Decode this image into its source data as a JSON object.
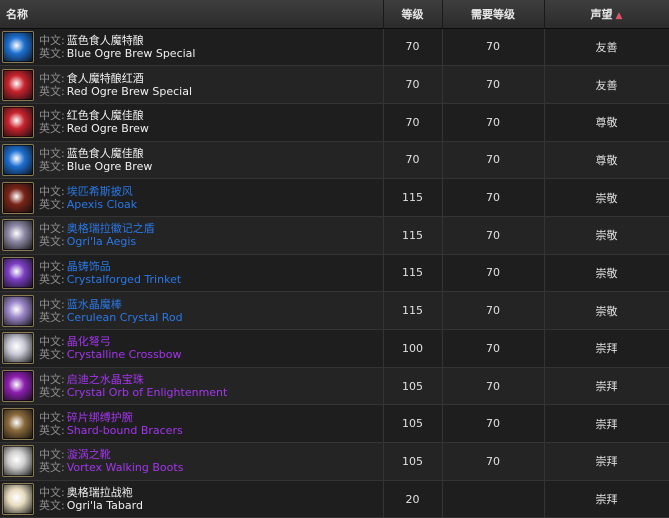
{
  "header": {
    "name": "名称",
    "level": "等级",
    "req_level": "需要等级",
    "reputation": "声望",
    "sort_arrow": "▲"
  },
  "labels": {
    "cn": "中文:",
    "en": "英文:"
  },
  "rows": [
    {
      "cn": "蓝色食人魔特酿",
      "en": "Blue Ogre Brew Special",
      "level": "70",
      "req": "70",
      "rep": "友善",
      "quality": "white",
      "icon": "blue-potion-icon",
      "color": "#1d6fd1"
    },
    {
      "cn": "食人魔特酿红酒",
      "en": "Red Ogre Brew Special",
      "level": "70",
      "req": "70",
      "rep": "友善",
      "quality": "white",
      "icon": "red-potion-icon",
      "color": "#c8232d"
    },
    {
      "cn": "红色食人魔佳酿",
      "en": "Red Ogre Brew",
      "level": "70",
      "req": "70",
      "rep": "尊敬",
      "quality": "white",
      "icon": "red-potion-icon",
      "color": "#c8232d"
    },
    {
      "cn": "蓝色食人魔佳酿",
      "en": "Blue Ogre Brew",
      "level": "70",
      "req": "70",
      "rep": "尊敬",
      "quality": "white",
      "icon": "blue-potion-icon",
      "color": "#1d6fd1"
    },
    {
      "cn": "埃匹希斯披风",
      "en": "Apexis Cloak",
      "level": "115",
      "req": "70",
      "rep": "崇敬",
      "quality": "blue",
      "icon": "cloak-icon",
      "color": "#7a2418"
    },
    {
      "cn": "奥格瑞拉徽记之盾",
      "en": "Ogri'la Aegis",
      "level": "115",
      "req": "70",
      "rep": "崇敬",
      "quality": "blue",
      "icon": "shield-icon",
      "color": "#8e8aa6"
    },
    {
      "cn": "晶铸饰品",
      "en": "Crystalforged Trinket",
      "level": "115",
      "req": "70",
      "rep": "崇敬",
      "quality": "blue",
      "icon": "crystal-trinket-icon",
      "color": "#7b3fc4"
    },
    {
      "cn": "蓝水晶魔棒",
      "en": "Cerulean Crystal Rod",
      "level": "115",
      "req": "70",
      "rep": "崇敬",
      "quality": "blue",
      "icon": "crystal-rod-icon",
      "color": "#9a86c8"
    },
    {
      "cn": "晶化弩弓",
      "en": "Crystalline Crossbow",
      "level": "100",
      "req": "70",
      "rep": "崇拜",
      "quality": "purple",
      "icon": "crossbow-icon",
      "color": "#c9c9d6"
    },
    {
      "cn": "启迪之水晶宝珠",
      "en": "Crystal Orb of Enlightenment",
      "level": "105",
      "req": "70",
      "rep": "崇拜",
      "quality": "purple",
      "icon": "orb-icon",
      "color": "#8c1fb0"
    },
    {
      "cn": "碎片绑缚护腕",
      "en": "Shard-bound Bracers",
      "level": "105",
      "req": "70",
      "rep": "崇拜",
      "quality": "purple",
      "icon": "bracers-icon",
      "color": "#8a6a3c"
    },
    {
      "cn": "漩涡之靴",
      "en": "Vortex Walking Boots",
      "level": "105",
      "req": "70",
      "rep": "崇拜",
      "quality": "purple",
      "icon": "boots-icon",
      "color": "#cfcfcf"
    },
    {
      "cn": "奥格瑞拉战袍",
      "en": "Ogri'la Tabard",
      "level": "20",
      "req": "",
      "rep": "崇拜",
      "quality": "white",
      "icon": "tabard-icon",
      "color": "#e8dcc0"
    }
  ]
}
